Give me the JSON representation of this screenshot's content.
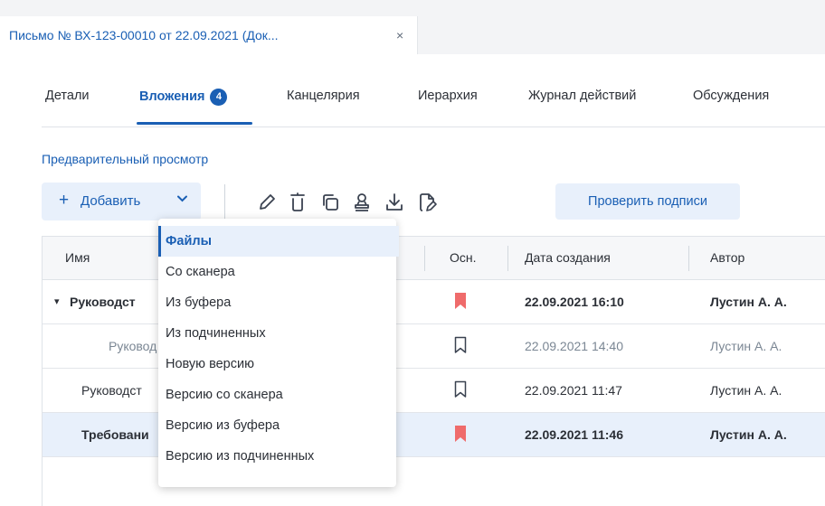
{
  "document_tab": {
    "title": "Письмо № ВХ-123-00010 от 22.09.2021 (Док...",
    "close": "×"
  },
  "nav_tabs": [
    {
      "label": "Детали"
    },
    {
      "label": "Вложения",
      "badge": "4",
      "active": true
    },
    {
      "label": "Канцелярия"
    },
    {
      "label": "Иерархия"
    },
    {
      "label": "Журнал действий"
    },
    {
      "label": "Обсуждения"
    }
  ],
  "preview_link": "Предварительный просмотр",
  "toolbar": {
    "add_label": "Добавить",
    "add_plus": "+",
    "add_chevron": "⌄",
    "icons": [
      "edit-icon",
      "delete-icon",
      "copy-icon",
      "sign-icon",
      "download-icon",
      "edit-file-icon"
    ],
    "check_signatures": "Проверить подписи"
  },
  "table": {
    "columns": [
      "Имя",
      "Осн.",
      "Дата создания",
      "Автор"
    ],
    "rows": [
      {
        "name": "Руководст",
        "expand": "▾",
        "main": true,
        "date": "22.09.2021 16:10",
        "author": "Лустин А. А.",
        "bold": true
      },
      {
        "name": "Руковод",
        "main": false,
        "date": "22.09.2021 14:40",
        "author": "Лустин А. А.",
        "muted": true
      },
      {
        "name": "Руководст",
        "main": false,
        "date": "22.09.2021 11:47",
        "author": "Лустин А. А."
      },
      {
        "name": "Требовани",
        "main": true,
        "date": "22.09.2021 11:46",
        "author": "Лустин А. А.",
        "bold": true,
        "selected": true
      }
    ]
  },
  "add_menu": {
    "items": [
      "Файлы",
      "Со сканера",
      "Из буфера",
      "Из подчиненных",
      "Новую версию",
      "Версию со сканера",
      "Версию из буфера",
      "Версию из подчиненных"
    ]
  },
  "colors": {
    "accent": "#1a5fb4",
    "flag": "#ef6b6b",
    "selected_bg": "#e8f0fb"
  }
}
